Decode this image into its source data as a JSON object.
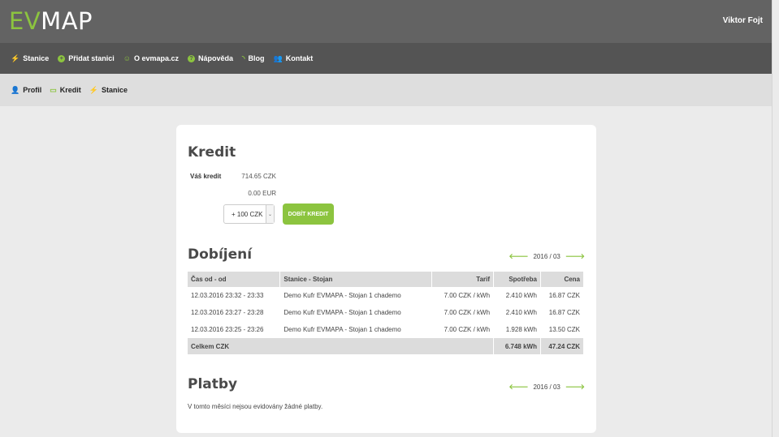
{
  "header": {
    "logo_ev": "EV",
    "logo_map": "MAP",
    "user_name": "Viktor Fojt"
  },
  "main_nav": [
    {
      "label": "Stanice",
      "icon": "bolt-icon"
    },
    {
      "label": "Přidat stanici",
      "icon": "plus-circle-icon"
    },
    {
      "label": "O evmapa.cz",
      "icon": "smiley-icon"
    },
    {
      "label": "Nápověda",
      "icon": "question-circle-icon"
    },
    {
      "label": "Blog",
      "icon": "rss-icon"
    },
    {
      "label": "Kontakt",
      "icon": "people-icon"
    }
  ],
  "sub_nav": [
    {
      "label": "Profil",
      "icon": "user-icon"
    },
    {
      "label": "Kredit",
      "icon": "card-icon"
    },
    {
      "label": "Stanice",
      "icon": "bolt-icon"
    }
  ],
  "credit": {
    "title": "Kredit",
    "label": "Váš kredit",
    "czk": "714.65 CZK",
    "eur": "0.00 EUR",
    "select_value": "+ 100 CZK",
    "button": "DOBÍT KREDIT"
  },
  "charging": {
    "title": "Dobíjení",
    "period": "2016 / 03",
    "columns": [
      "Čas od - od",
      "Stanice - Stojan",
      "Tarif",
      "Spotřeba",
      "Cena"
    ],
    "rows": [
      [
        "12.03.2016 23:32 - 23:33",
        "Demo Kufr EVMAPA - Stojan 1 chademo",
        "7.00 CZK / kWh",
        "2.410 kWh",
        "16.87 CZK"
      ],
      [
        "12.03.2016 23:27 - 23:28",
        "Demo Kufr EVMAPA - Stojan 1 chademo",
        "7.00 CZK / kWh",
        "2.410 kWh",
        "16.87 CZK"
      ],
      [
        "12.03.2016 23:25 - 23:26",
        "Demo Kufr EVMAPA - Stojan 1 chademo",
        "7.00 CZK / kWh",
        "1.928 kWh",
        "13.50 CZK"
      ]
    ],
    "total_label": "Celkem CZK",
    "total_energy": "6.748 kWh",
    "total_price": "47.24 CZK"
  },
  "payments": {
    "title": "Platby",
    "period": "2016 / 03",
    "empty_note": "V tomto měsíci nejsou evidovány žádné platby."
  },
  "colors": {
    "accent": "#8cc43f",
    "topbar": "#636363",
    "nav": "#545454"
  }
}
